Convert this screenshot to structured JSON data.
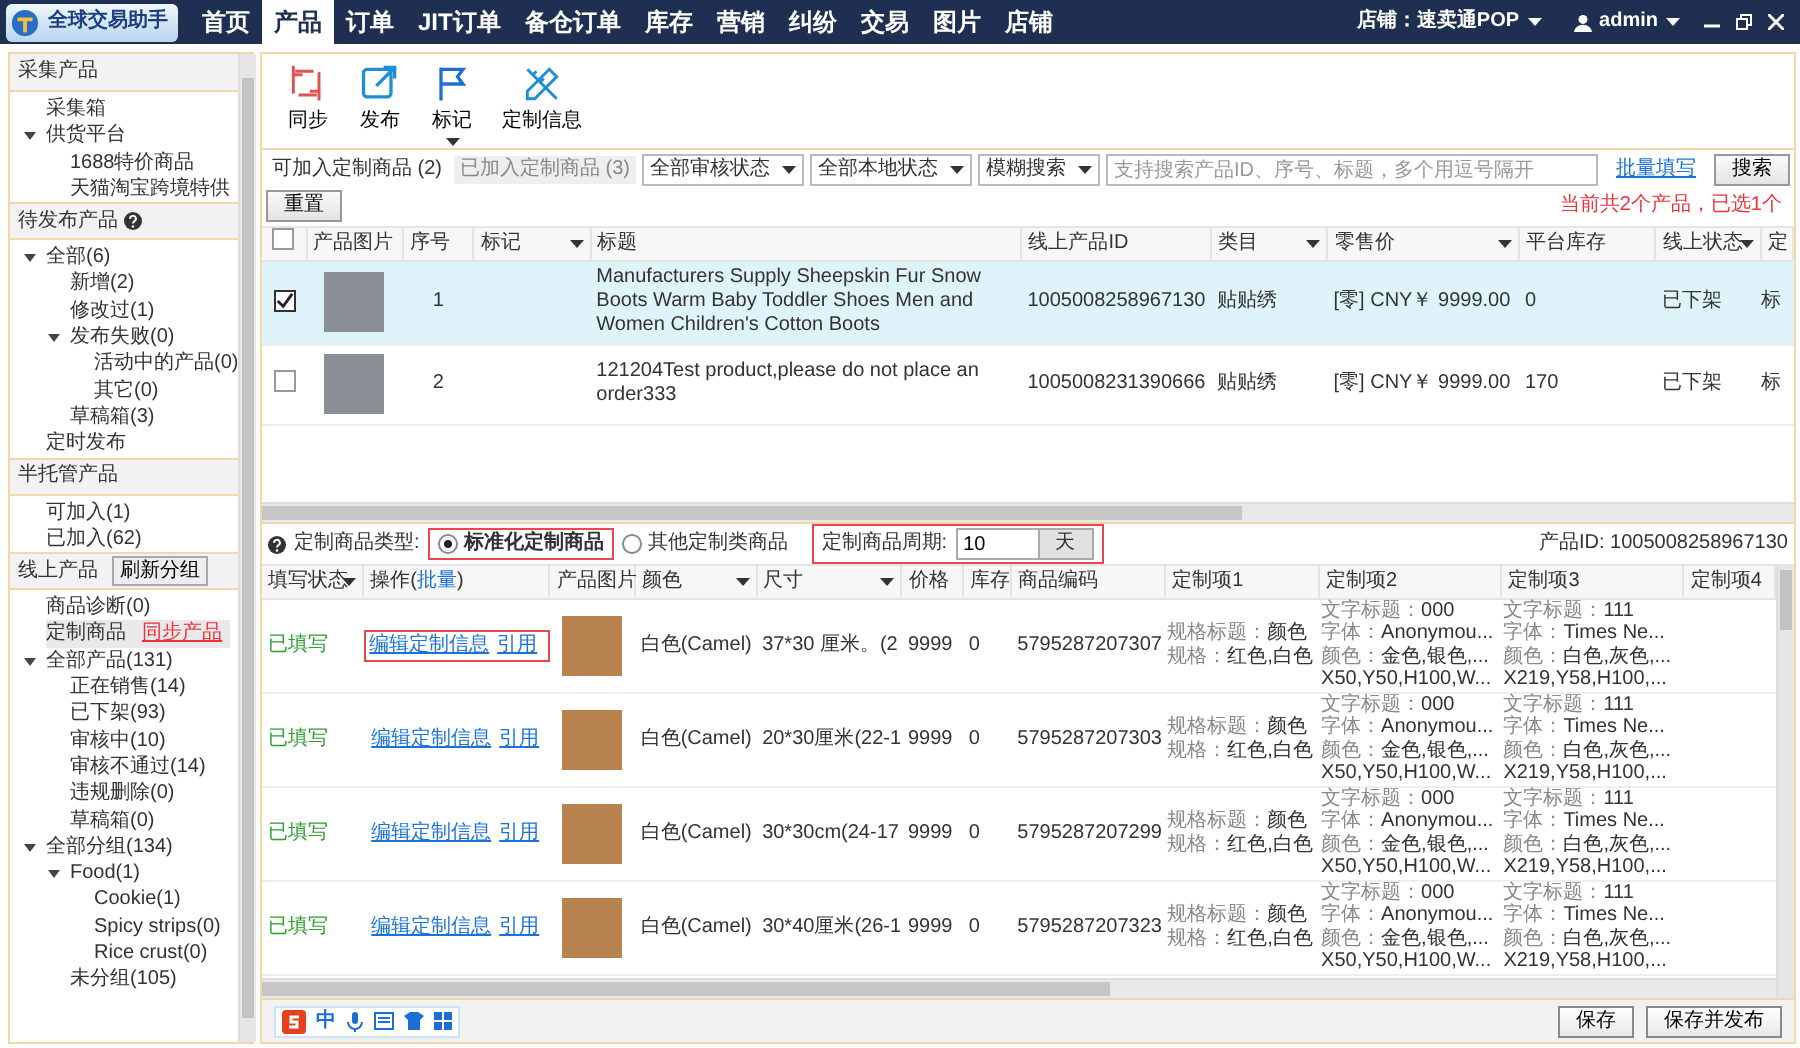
{
  "app": {
    "title": "全球交易助手"
  },
  "nav": {
    "tabs": [
      {
        "label": "首页",
        "selected": false
      },
      {
        "label": "产品",
        "selected": true
      },
      {
        "label": "订单",
        "selected": false
      },
      {
        "label": "JIT订单",
        "selected": false
      },
      {
        "label": "备仓订单",
        "selected": false
      },
      {
        "label": "库存",
        "selected": false
      },
      {
        "label": "营销",
        "selected": false
      },
      {
        "label": "纠纷",
        "selected": false
      },
      {
        "label": "交易",
        "selected": false
      },
      {
        "label": "图片",
        "selected": false
      },
      {
        "label": "店铺",
        "selected": false
      }
    ],
    "shop": "店铺：速卖通POP",
    "user": "admin"
  },
  "sidebar": {
    "sections": [
      {
        "title": "采集产品",
        "help": false,
        "items": [
          {
            "label": "采集箱",
            "selected": false
          },
          {
            "label": "供货平台",
            "selected": false,
            "expanded": true,
            "children": [
              {
                "label": "1688特价商品",
                "selected": false
              },
              {
                "label": "天猫淘宝跨境特供",
                "selected": false
              }
            ]
          }
        ]
      },
      {
        "title": "待发布产品",
        "help": true,
        "items": [
          {
            "label": "全部(6)",
            "selected": false,
            "expanded": true,
            "children": [
              {
                "label": "新增(2)",
                "selected": false
              },
              {
                "label": "修改过(1)",
                "selected": false
              },
              {
                "label": "发布失败(0)",
                "selected": false,
                "expanded": true,
                "children": [
                  {
                    "label": "活动中的产品(0)",
                    "selected": false
                  },
                  {
                    "label": "其它(0)",
                    "selected": false
                  }
                ]
              },
              {
                "label": "草稿箱(3)",
                "selected": false
              }
            ]
          },
          {
            "label": "定时发布",
            "selected": false
          }
        ]
      },
      {
        "title": "半托管产品",
        "help": false,
        "items": [
          {
            "label": "可加入(1)",
            "selected": false
          },
          {
            "label": "已加入(62)",
            "selected": false
          }
        ]
      },
      {
        "title": "线上产品",
        "help": false,
        "button": "刷新分组",
        "items": [
          {
            "label": "商品诊断(0)",
            "selected": false
          },
          {
            "label": "定制商品",
            "selected": true,
            "link": "同步产品"
          },
          {
            "label": "全部产品(131)",
            "selected": false,
            "expanded": true,
            "children": [
              {
                "label": "正在销售(14)",
                "selected": false
              },
              {
                "label": "已下架(93)",
                "selected": false
              },
              {
                "label": "审核中(10)",
                "selected": false
              },
              {
                "label": "审核不通过(14)",
                "selected": false
              },
              {
                "label": "违规删除(0)",
                "selected": false
              },
              {
                "label": "草稿箱(0)",
                "selected": false
              }
            ]
          },
          {
            "label": "全部分组(134)",
            "selected": false,
            "expanded": true,
            "children": [
              {
                "label": "Food(1)",
                "selected": false,
                "expanded": true,
                "children": [
                  {
                    "label": "Cookie(1)",
                    "selected": false
                  },
                  {
                    "label": "Spicy strips(0)",
                    "selected": false
                  },
                  {
                    "label": "Rice crust(0)",
                    "selected": false
                  }
                ]
              },
              {
                "label": "未分组(105)",
                "selected": false
              }
            ]
          }
        ]
      }
    ]
  },
  "toolbar": [
    {
      "label": "同步",
      "kind": "sync",
      "menu": false
    },
    {
      "label": "发布",
      "kind": "publish",
      "menu": false
    },
    {
      "label": "标记",
      "kind": "flag",
      "menu": true
    },
    {
      "label": "定制信息",
      "kind": "custom",
      "menu": false
    }
  ],
  "filter": {
    "tabs": [
      {
        "label": "可加入定制商品 (2)",
        "selected": true
      },
      {
        "label": "已加入定制商品 (3)",
        "selected": false
      }
    ],
    "selects": [
      "全部审核状态",
      "全部本地状态",
      "模糊搜索"
    ],
    "search_placeholder": "支持搜索产品ID、序号、标题，多个用逗号隔开",
    "bulk_link": "批量填写",
    "buttons": [
      "搜索",
      "重置"
    ],
    "summary": "当前共2个产品，已选1个"
  },
  "products": {
    "header_checked": false,
    "columns": [
      {
        "label": "产品图片",
        "filter": false
      },
      {
        "label": "序号",
        "filter": false
      },
      {
        "label": "标记",
        "filter": true
      },
      {
        "label": "标题",
        "filter": false
      },
      {
        "label": "线上产品ID",
        "filter": false
      },
      {
        "label": "类目",
        "filter": true
      },
      {
        "label": "零售价",
        "filter": true
      },
      {
        "label": "平台库存",
        "filter": false
      },
      {
        "label": "线上状态",
        "filter": true
      },
      {
        "label": "定",
        "filter": false
      }
    ],
    "rows": [
      {
        "checked": true,
        "no": "1",
        "title": "Manufacturers Supply Sheepskin Fur Snow Boots Warm Baby Toddler Shoes Men and Women Children's Cotton Boots",
        "product_id": "1005008258967130",
        "category": "贴贴绣",
        "price": "[零] CNY￥ 9999.00",
        "stock": "0",
        "status": "已下架",
        "column_11": "标"
      },
      {
        "checked": false,
        "no": "2",
        "title": "121204Test product,please do not place an order333",
        "product_id": "1005008231390666",
        "category": "贴贴绣",
        "price": "[零] CNY￥ 9999.00",
        "stock": "170",
        "status": "已下架",
        "column_11": "标"
      }
    ]
  },
  "options": {
    "type_label": "定制商品类型:",
    "types": [
      {
        "label": "标准化定制商品",
        "selected": true,
        "highlighted": true
      },
      {
        "label": "其他定制类商品",
        "selected": false,
        "highlighted": false
      }
    ],
    "period_label": "定制商品周期:",
    "period_value": "10",
    "period_unit": "天",
    "period_highlighted": true,
    "product_id": "产品ID: 1005008258967130"
  },
  "variants": {
    "columns": [
      {
        "label": "填写状态",
        "filter": true
      },
      {
        "label": "操作(",
        "link": "批量",
        "label_end": ")",
        "filter": false
      },
      {
        "label": "产品图片",
        "filter": false
      },
      {
        "label": "颜色",
        "filter": true
      },
      {
        "label": "尺寸",
        "filter": true
      },
      {
        "label": "价格",
        "filter": false
      },
      {
        "label": "库存",
        "filter": false
      },
      {
        "label": "商品编码",
        "filter": false
      },
      {
        "label": "定制项1",
        "filter": false
      },
      {
        "label": "定制项2",
        "filter": false
      },
      {
        "label": "定制项3",
        "filter": false
      },
      {
        "label": "定制项4",
        "filter": false
      }
    ],
    "rows": [
      {
        "status": "已填写",
        "filled": true,
        "highlighted": true,
        "actions": [
          "编辑定制信息",
          "引用"
        ],
        "color_option": "白色(Camel)",
        "size": "37*30 厘米。(2",
        "price": "9999",
        "stock": "0",
        "code": "5795287207307",
        "custom": [
          [
            {
              "label": "规格标题：",
              "value": "颜色"
            },
            {
              "label": "规格：",
              "value": "红色,白色"
            }
          ],
          [
            {
              "label": "文字标题：",
              "value": "000"
            },
            {
              "label": "字体：",
              "value": "Anonymou..."
            },
            {
              "label": "颜色：",
              "value": "金色,银色,..."
            },
            {
              "value": "X50,Y50,H100,W..."
            }
          ],
          [
            {
              "label": "文字标题：",
              "value": "111"
            },
            {
              "label": "字体：",
              "value": "Times Ne..."
            },
            {
              "label": "颜色：",
              "value": "白色,灰色,..."
            },
            {
              "value": "X219,Y58,H100,..."
            }
          ]
        ]
      },
      {
        "status": "已填写",
        "filled": true,
        "highlighted": false,
        "actions": [
          "编辑定制信息",
          "引用"
        ],
        "color_option": "白色(Camel)",
        "size": "20*30厘米(22-1",
        "price": "9999",
        "stock": "0",
        "code": "5795287207303",
        "custom": [
          [
            {
              "label": "规格标题：",
              "value": "颜色"
            },
            {
              "label": "规格：",
              "value": "红色,白色"
            }
          ],
          [
            {
              "label": "文字标题：",
              "value": "000"
            },
            {
              "label": "字体：",
              "value": "Anonymou..."
            },
            {
              "label": "颜色：",
              "value": "金色,银色,..."
            },
            {
              "value": "X50,Y50,H100,W..."
            }
          ],
          [
            {
              "label": "文字标题：",
              "value": "111"
            },
            {
              "label": "字体：",
              "value": "Times Ne..."
            },
            {
              "label": "颜色：",
              "value": "白色,灰色,..."
            },
            {
              "value": "X219,Y58,H100,..."
            }
          ]
        ]
      },
      {
        "status": "已填写",
        "filled": true,
        "highlighted": false,
        "actions": [
          "编辑定制信息",
          "引用"
        ],
        "color_option": "白色(Camel)",
        "size": "30*30cm(24-17",
        "price": "9999",
        "stock": "0",
        "code": "5795287207299",
        "custom": [
          [
            {
              "label": "规格标题：",
              "value": "颜色"
            },
            {
              "label": "规格：",
              "value": "红色,白色"
            }
          ],
          [
            {
              "label": "文字标题：",
              "value": "000"
            },
            {
              "label": "字体：",
              "value": "Anonymou..."
            },
            {
              "label": "颜色：",
              "value": "金色,银色,..."
            },
            {
              "value": "X50,Y50,H100,W..."
            }
          ],
          [
            {
              "label": "文字标题：",
              "value": "111"
            },
            {
              "label": "字体：",
              "value": "Times Ne..."
            },
            {
              "label": "颜色：",
              "value": "白色,灰色,..."
            },
            {
              "value": "X219,Y58,H100,..."
            }
          ]
        ]
      },
      {
        "status": "已填写",
        "filled": true,
        "highlighted": false,
        "actions": [
          "编辑定制信息",
          "引用"
        ],
        "color_option": "白色(Camel)",
        "size": "30*40厘米(26-1",
        "price": "9999",
        "stock": "0",
        "code": "5795287207323",
        "custom": [
          [
            {
              "label": "规格标题：",
              "value": "颜色"
            },
            {
              "label": "规格：",
              "value": "红色,白色"
            }
          ],
          [
            {
              "label": "文字标题：",
              "value": "000"
            },
            {
              "label": "字体：",
              "value": "Anonymou..."
            },
            {
              "label": "颜色：",
              "value": "金色,银色,..."
            },
            {
              "value": "X50,Y50,H100,W..."
            }
          ],
          [
            {
              "label": "文字标题：",
              "value": "111"
            },
            {
              "label": "字体：",
              "value": "Times Ne..."
            },
            {
              "label": "颜色：",
              "value": "白色,灰色,..."
            },
            {
              "value": "X219,Y58,H100,..."
            }
          ]
        ]
      }
    ]
  },
  "ime_bar": {
    "label": "中"
  },
  "footer": {
    "buttons": [
      "保存",
      "保存并发布"
    ]
  }
}
